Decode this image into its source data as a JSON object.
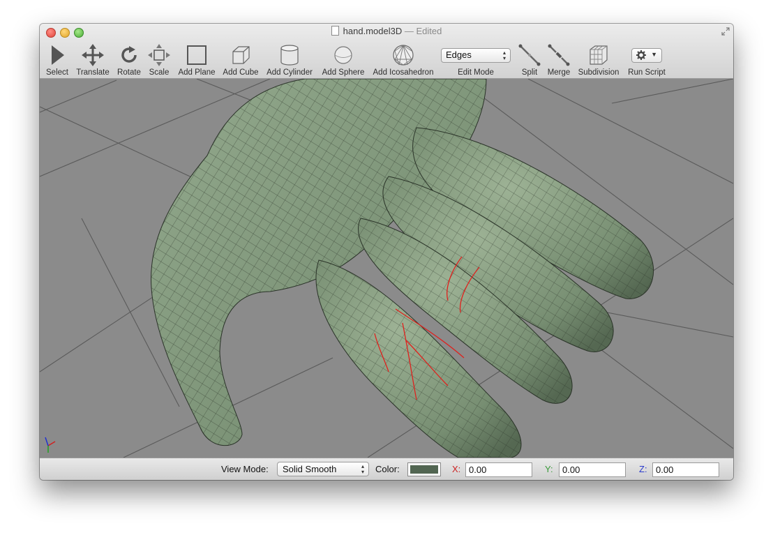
{
  "window": {
    "title": "hand.model3D",
    "title_separator": "—",
    "status": "Edited"
  },
  "toolbar": {
    "tools": [
      {
        "id": "select",
        "label": "Select",
        "icon": "arrow-cursor-icon"
      },
      {
        "id": "translate",
        "label": "Translate",
        "icon": "move-arrows-icon"
      },
      {
        "id": "rotate",
        "label": "Rotate",
        "icon": "rotate-icon"
      },
      {
        "id": "scale",
        "label": "Scale",
        "icon": "scale-icon"
      },
      {
        "id": "add-plane",
        "label": "Add Plane",
        "icon": "plane-icon"
      },
      {
        "id": "add-cube",
        "label": "Add Cube",
        "icon": "cube-icon"
      },
      {
        "id": "add-cylinder",
        "label": "Add Cylinder",
        "icon": "cylinder-icon"
      },
      {
        "id": "add-sphere",
        "label": "Add Sphere",
        "icon": "sphere-icon"
      },
      {
        "id": "add-icosahedron",
        "label": "Add Icosahedron",
        "icon": "icosahedron-icon"
      }
    ],
    "edit_mode": {
      "label": "Edit Mode",
      "value": "Edges"
    },
    "tools_right": [
      {
        "id": "split",
        "label": "Split",
        "icon": "split-icon"
      },
      {
        "id": "merge",
        "label": "Merge",
        "icon": "merge-icon"
      },
      {
        "id": "subdivision",
        "label": "Subdivision",
        "icon": "subdivision-icon"
      }
    ],
    "run_script": {
      "label": "Run Script",
      "icon": "gear-icon"
    }
  },
  "viewport": {
    "background_color": "#8b8b8b",
    "mesh_color": "#7d9478",
    "selected_edge_color": "#e0201c",
    "axis_colors": {
      "x": "#d02020",
      "y": "#20a020",
      "z": "#2030d0"
    }
  },
  "statusbar": {
    "view_mode_label": "View Mode:",
    "view_mode_value": "Solid Smooth",
    "color_label": "Color:",
    "color_value": "#526652",
    "x_label": "X:",
    "x_value": "0.00",
    "y_label": "Y:",
    "y_value": "0.00",
    "z_label": "Z:",
    "z_value": "0.00",
    "x_color": "#cc2222",
    "y_color": "#3a9a3a",
    "z_color": "#2a3acc"
  }
}
